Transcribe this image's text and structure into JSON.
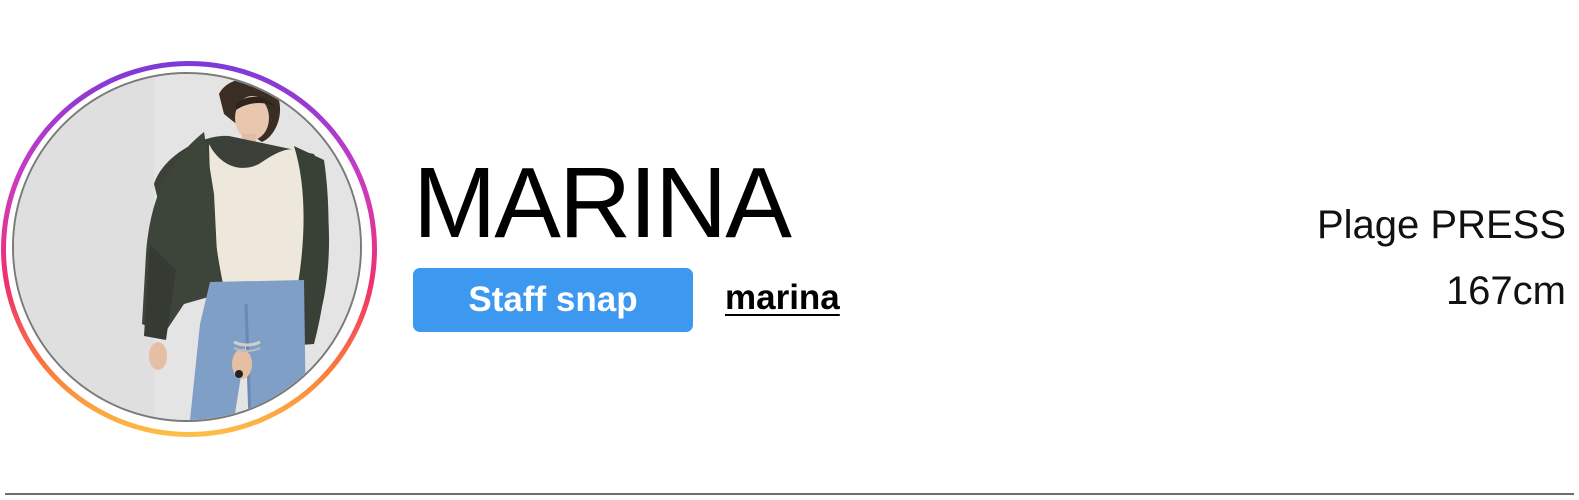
{
  "profile": {
    "display_name": "MARINA",
    "staff_snap_label": "Staff snap",
    "username": "marina",
    "affiliation": "Plage PRESS",
    "height": "167cm"
  },
  "avatar": {
    "icon": "profile-photo",
    "ring_colors": [
      "#7b3ad9",
      "#c93bc4",
      "#f0306f",
      "#fb7a3a",
      "#fdc048"
    ]
  },
  "colors": {
    "button_background": "#3d98ef",
    "button_text": "#ffffff",
    "divider": "#6e6e6e"
  }
}
